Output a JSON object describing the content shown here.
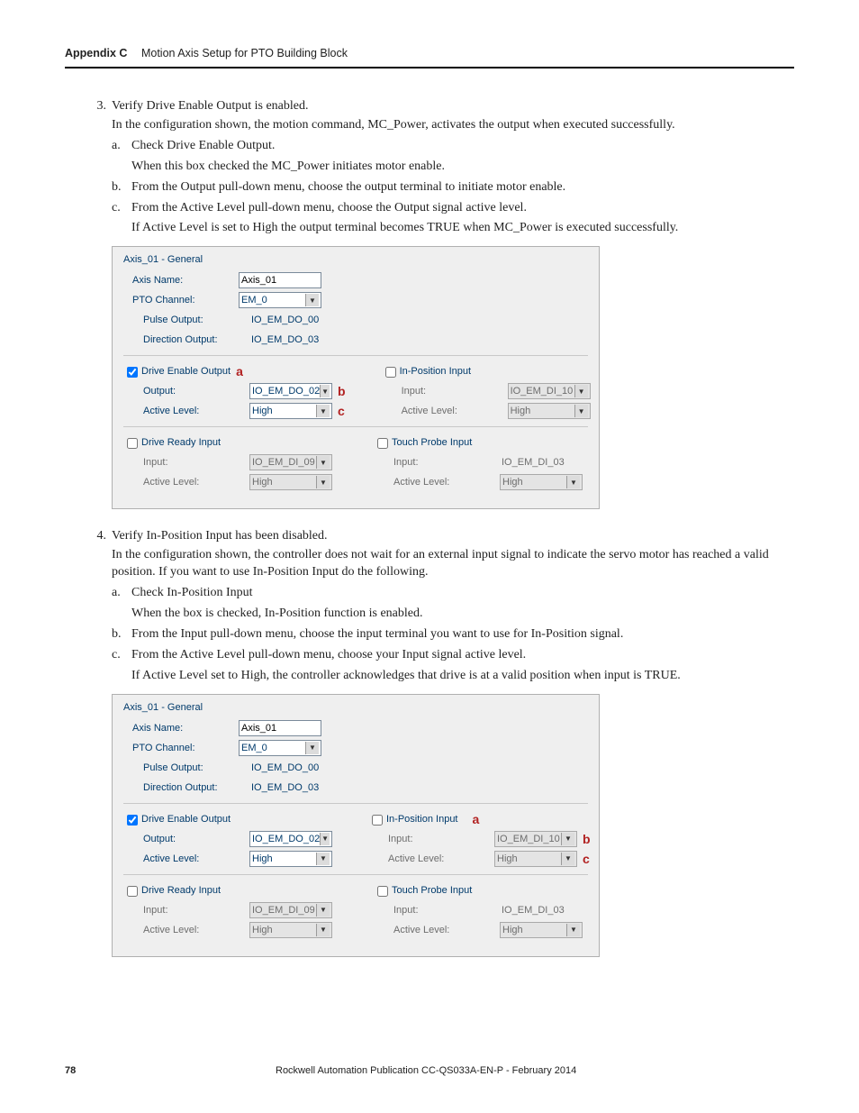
{
  "header": {
    "appendix": "Appendix C",
    "title": "Motion Axis Setup for PTO Building Block"
  },
  "step3": {
    "num": "3.",
    "heading": "Verify Drive Enable Output is enabled.",
    "intro": "In the configuration shown, the motion command, MC_Power, activates the output when executed successfully.",
    "a_label": "a.",
    "a_text": "Check Drive Enable Output.",
    "a_cont": "When this box checked the MC_Power initiates motor enable.",
    "b_label": "b.",
    "b_text": "From the Output pull-down menu, choose the output terminal to initiate motor enable.",
    "c_label": "c.",
    "c_text": "From the Active Level pull-down menu, choose the Output signal active level.",
    "c_cont": "If Active Level is set to High the output terminal becomes TRUE when MC_Power is executed successfully."
  },
  "step4": {
    "num": "4.",
    "heading": "Verify In-Position Input has been disabled.",
    "intro": "In the configuration shown, the controller does not wait for an external input signal to indicate the servo motor has reached a valid position. If you want to use In-Position Input do the following.",
    "a_label": "a.",
    "a_text": "Check In-Position Input",
    "a_cont": "When the box is checked, In-Position function is enabled.",
    "b_label": "b.",
    "b_text": "From the Input pull-down menu, choose the input terminal you want to use for In-Position signal.",
    "c_label": "c.",
    "c_text": "From the Active Level pull-down menu, choose your Input signal active level.",
    "c_cont": "If Active Level set to High, the controller acknowledges that drive is at a valid position when input is TRUE."
  },
  "shot": {
    "groupTitle": "Axis_01 - General",
    "axisName_lbl": "Axis Name:",
    "axisName_val": "Axis_01",
    "ptoChannel_lbl": "PTO Channel:",
    "ptoChannel_val": "EM_0",
    "pulseOut_lbl": "Pulse Output:",
    "pulseOut_val": "IO_EM_DO_00",
    "dirOut_lbl": "Direction Output:",
    "dirOut_val": "IO_EM_DO_03",
    "driveEnable_chk": "Drive Enable Output",
    "output_lbl": "Output:",
    "output_val": "IO_EM_DO_02",
    "activeLevel_lbl": "Active Level:",
    "activeLevel_val": "High",
    "inPos_chk": "In-Position Input",
    "input_lbl": "Input:",
    "input_val": "IO_EM_DI_10",
    "driveReady_chk": "Drive Ready Input",
    "driveReady_input_val": "IO_EM_DI_09",
    "driveReady_level_val": "High",
    "touchProbe_chk": "Touch Probe Input",
    "touchProbe_input_val": "IO_EM_DI_03",
    "touchProbe_level_val": "High",
    "annot_a": "a",
    "annot_b": "b",
    "annot_c": "c"
  },
  "footer": {
    "page": "78",
    "pub": "Rockwell Automation Publication CC-QS033A-EN-P - February 2014"
  }
}
